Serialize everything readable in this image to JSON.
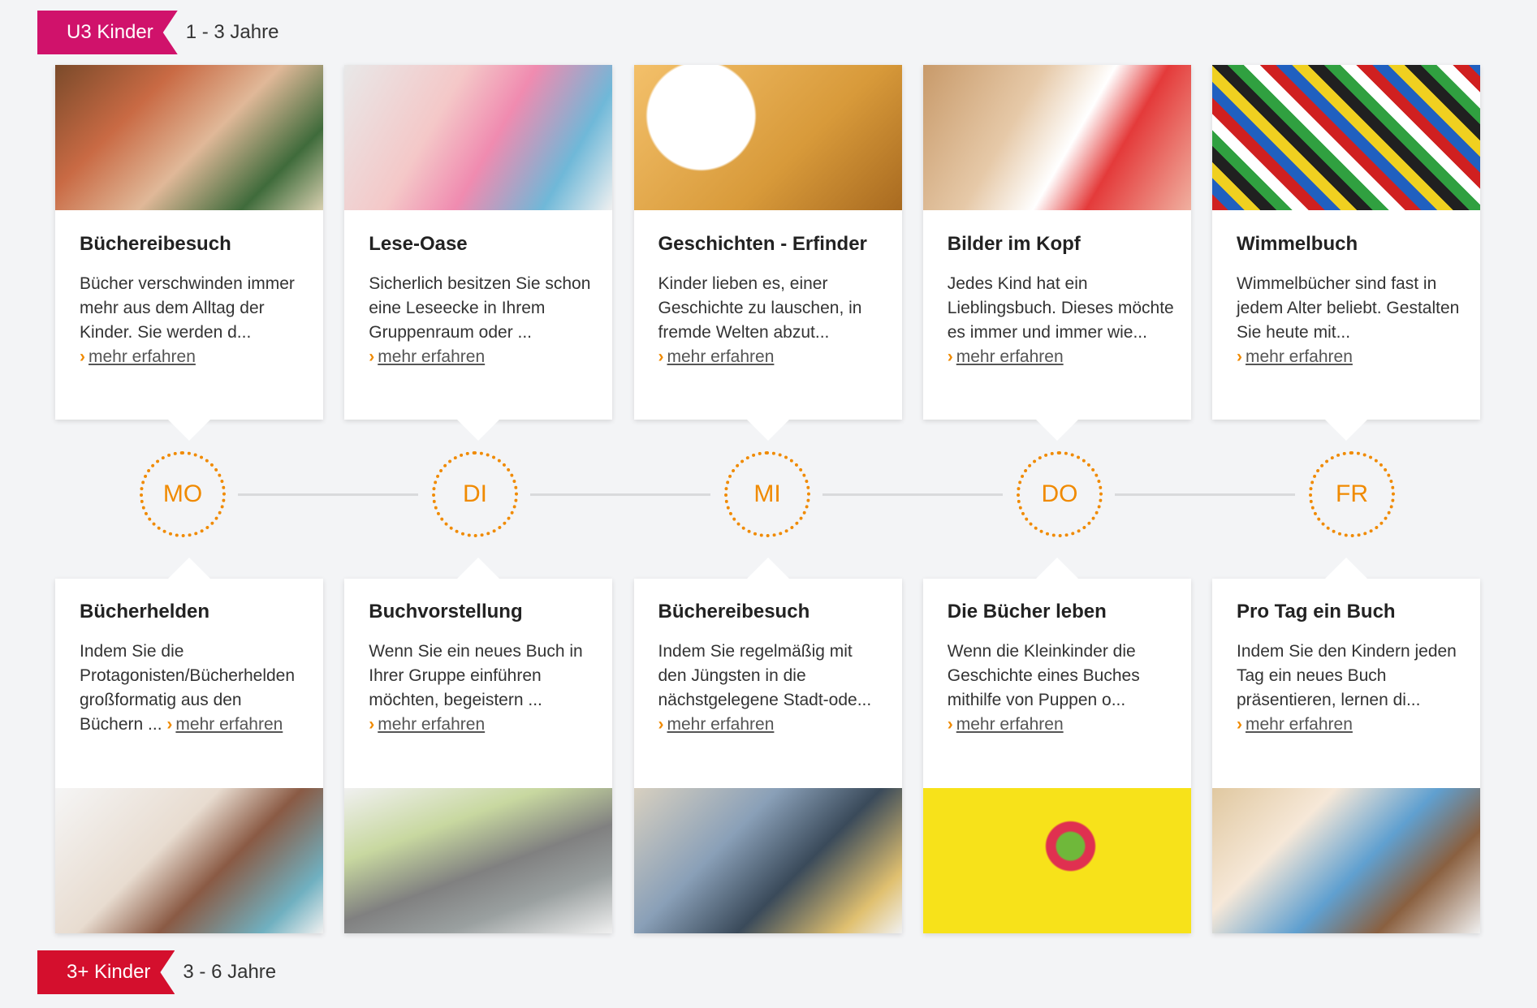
{
  "top_band": {
    "label": "U3 Kinder",
    "range": "1 - 3 Jahre",
    "color": "#d0126b"
  },
  "bottom_band": {
    "label": "3+ Kinder",
    "range": "3 - 6 Jahre",
    "color": "#d40f2d"
  },
  "accent_color": "#f08a00",
  "days": [
    "MO",
    "DI",
    "MI",
    "DO",
    "FR"
  ],
  "upper_cards": [
    {
      "title": "Büchereibesuch",
      "text": "Bücher verschwinden immer mehr aus dem Alltag der Kinder. Sie werden d...",
      "more": "mehr erfahren",
      "image": "kids-reading-in-library"
    },
    {
      "title": "Lese-Oase",
      "text": "Sicherlich besitzen Sie schon eine Leseecke in Ihrem Gruppenraum oder ...",
      "more": "mehr erfahren",
      "image": "toddler-reading-book"
    },
    {
      "title": "Geschichten - Erfinder",
      "text": "Kinder lieben es, einer Geschichte zu lauschen, in fremde Welten abzut...",
      "more": "mehr erfahren",
      "image": "boy-with-thought-bubble"
    },
    {
      "title": "Bilder im Kopf",
      "text": "Jedes Kind hat ein Lieblingsbuch. Dieses möchte es immer und immer wie...",
      "more": "mehr erfahren",
      "image": "child-drawing"
    },
    {
      "title": "Wimmelbuch",
      "text": "Wimmelbücher sind fast in jedem Alter beliebt. Gestalten Sie heute mit...",
      "more": "mehr erfahren",
      "image": "building-bricks"
    }
  ],
  "lower_cards": [
    {
      "title": "Bücherhelden",
      "text": "Indem Sie die Protagonisten/Bücherhelden großformatig aus den Büchern ...",
      "more": "mehr erfahren",
      "image": "baby-with-book"
    },
    {
      "title": "Buchvorstellung",
      "text": "Wenn Sie ein neues Buch in Ihrer Gruppe einführen möchten, begeistern ...",
      "more": "mehr erfahren",
      "image": "plush-elephant-on-book"
    },
    {
      "title": "Büchereibesuch",
      "text": "Indem Sie regelmäßig mit den Jüngsten in die nächstgelegene Stadt-ode...",
      "more": "mehr erfahren",
      "image": "toddler-in-library"
    },
    {
      "title": "Die Bücher leben",
      "text": "Wenn die Kleinkinder die Geschichte eines Buches mithilfe von Puppen o...",
      "more": "mehr erfahren",
      "image": "finger-puppets"
    },
    {
      "title": "Pro Tag ein Buch",
      "text": "Indem Sie den Kindern jeden Tag ein neues Buch präsentieren, lernen di...",
      "more": "mehr erfahren",
      "image": "teacher-reading-to-kids"
    }
  ]
}
